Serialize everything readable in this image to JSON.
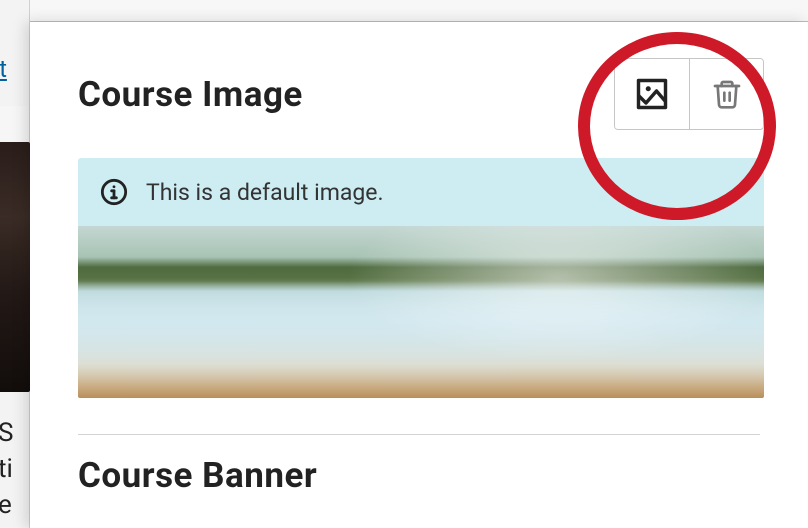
{
  "left_ghost": {
    "link_fragment": "ult",
    "text_lines": [
      "S",
      "ti",
      "e"
    ]
  },
  "sections": {
    "image": {
      "title": "Course Image",
      "notice": "This is a default image."
    },
    "banner": {
      "title": "Course Banner"
    }
  },
  "buttons": {
    "upload": "Upload image",
    "delete": "Delete image"
  }
}
